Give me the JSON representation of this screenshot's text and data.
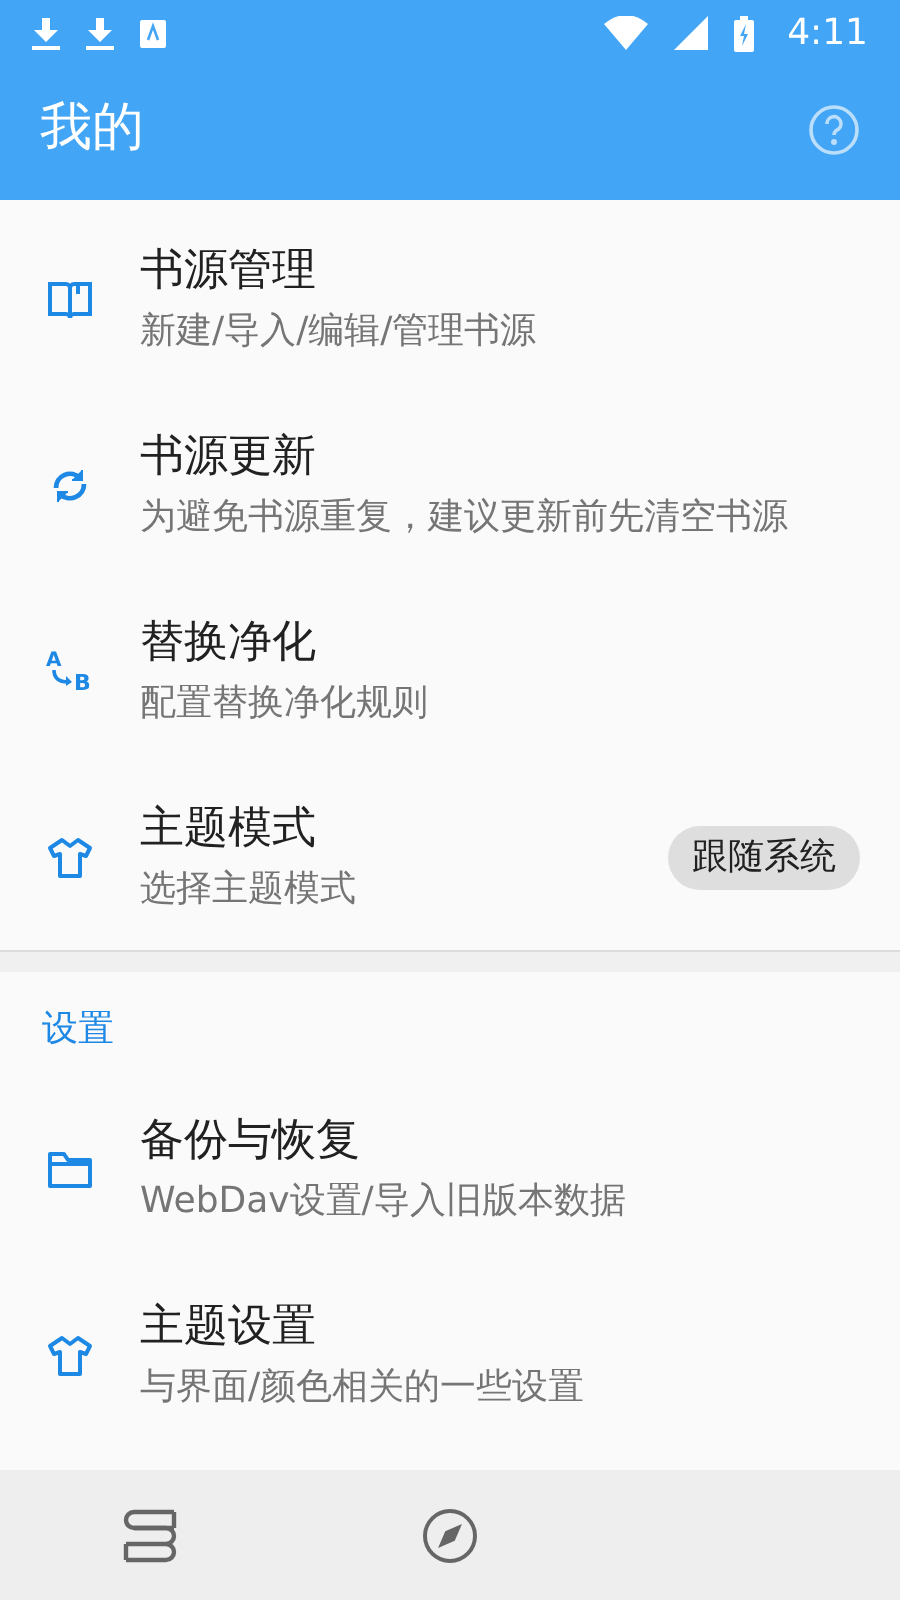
{
  "status_bar": {
    "time": "4:11"
  },
  "header": {
    "title": "我的"
  },
  "main_items": [
    {
      "kind": "book",
      "title": "书源管理",
      "subtitle": "新建/导入/编辑/管理书源"
    },
    {
      "kind": "sync",
      "title": "书源更新",
      "subtitle": "为避免书源重复，建议更新前先清空书源"
    },
    {
      "kind": "ab",
      "icon_text": [
        "A",
        "B"
      ],
      "title": "替换净化",
      "subtitle": "配置替换净化规则"
    },
    {
      "kind": "shirt",
      "title": "主题模式",
      "subtitle": "选择主题模式",
      "value": "跟随系统"
    }
  ],
  "settings_section": {
    "heading": "设置",
    "items": [
      {
        "kind": "folder",
        "title": "备份与恢复",
        "subtitle": "WebDav设置/导入旧版本数据"
      },
      {
        "kind": "shirt",
        "title": "主题设置",
        "subtitle": "与界面/颜色相关的一些设置"
      }
    ]
  },
  "bottom_nav": [
    {
      "kind": "books"
    },
    {
      "kind": "compass"
    }
  ]
}
